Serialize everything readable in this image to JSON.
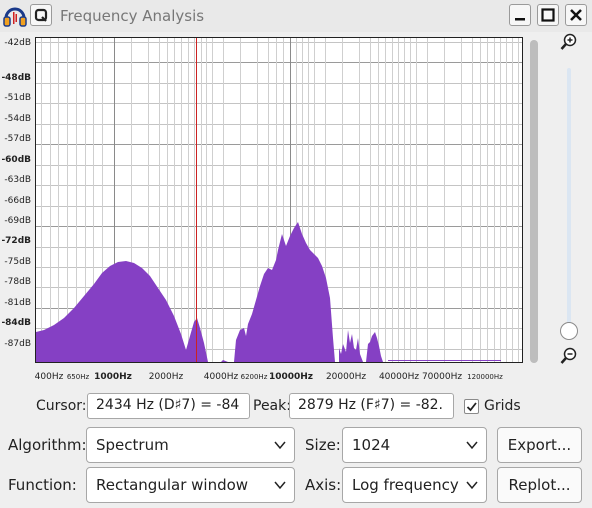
{
  "window": {
    "title": "Frequency Analysis"
  },
  "plot": {
    "y_labels": [
      {
        "text": "-42dB",
        "major": false
      },
      {
        "text": "-48dB",
        "major": true
      },
      {
        "text": "-51dB",
        "major": false
      },
      {
        "text": "-54dB",
        "major": false
      },
      {
        "text": "-57dB",
        "major": false
      },
      {
        "text": "-60dB",
        "major": true
      },
      {
        "text": "-63dB",
        "major": false
      },
      {
        "text": "-66dB",
        "major": false
      },
      {
        "text": "-69dB",
        "major": false
      },
      {
        "text": "-72dB",
        "major": true
      },
      {
        "text": "-75dB",
        "major": false
      },
      {
        "text": "-78dB",
        "major": false
      },
      {
        "text": "-81dB",
        "major": false
      },
      {
        "text": "-84dB",
        "major": true
      },
      {
        "text": "-87dB",
        "major": false
      }
    ],
    "x_labels": [
      {
        "text": "400Hz",
        "small": false,
        "major": false
      },
      {
        "text": "650Hz",
        "small": true,
        "major": false
      },
      {
        "text": "1000Hz",
        "small": false,
        "major": true
      },
      {
        "text": "2000Hz",
        "small": false,
        "major": false
      },
      {
        "text": "4000Hz",
        "small": false,
        "major": false
      },
      {
        "text": "6200Hz",
        "small": true,
        "major": false
      },
      {
        "text": "10000Hz",
        "small": false,
        "major": true
      },
      {
        "text": "20000Hz",
        "small": false,
        "major": false
      },
      {
        "text": "40000Hz",
        "small": false,
        "major": false
      },
      {
        "text": "70000Hz",
        "small": false,
        "major": false
      },
      {
        "text": "120000Hz",
        "small": true,
        "major": false
      }
    ],
    "fill_color": "#8540c4",
    "cursor_color": "#cc2222"
  },
  "cursor": {
    "label": "Cursor:",
    "value": "2434 Hz (D♯7) = -84"
  },
  "peak": {
    "label": "Peak:",
    "value": "2879 Hz (F♯7) = -82."
  },
  "grids": {
    "label": "Grids",
    "checked": true
  },
  "algorithm": {
    "label": "Algorithm:",
    "value": "Spectrum"
  },
  "size": {
    "label": "Size:",
    "value": "1024"
  },
  "function": {
    "label": "Function:",
    "value": "Rectangular window"
  },
  "axis": {
    "label": "Axis:",
    "value": "Log frequency"
  },
  "buttons": {
    "export": "Export...",
    "replot": "Replot..."
  }
}
